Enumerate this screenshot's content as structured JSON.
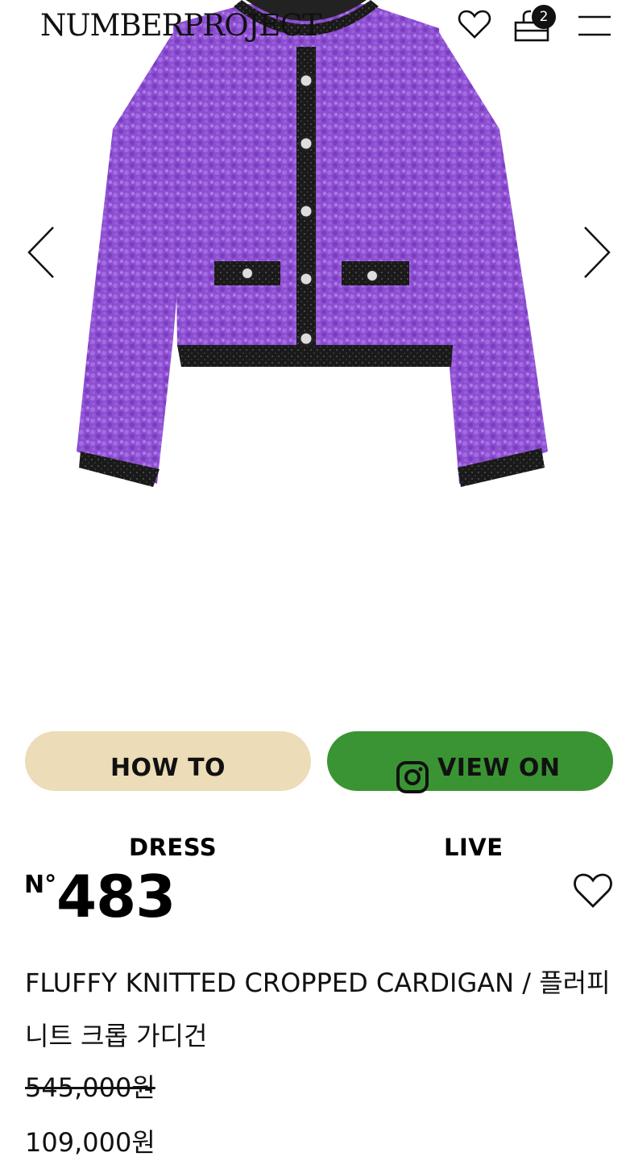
{
  "header": {
    "logo": "NUMBERPROJECT",
    "cart_count": "2"
  },
  "gallery": {
    "product_color": "#8a4ad0",
    "trim_color": "#1a1a1a"
  },
  "buttons": {
    "howto_label": "HOW TO",
    "howto_sub": "DRESS",
    "howto_color": "#ecdcb7",
    "live_label": "VIEW ON",
    "live_sub": "LIVE",
    "live_color": "#3a9433"
  },
  "product": {
    "number_prefix": "N°",
    "number": "483",
    "title": "FLUFFY KNITTED CROPPED CARDIGAN / 플러피 니트 크롭 가디건",
    "price_original": "545,000원",
    "price_sale": "109,000원"
  }
}
